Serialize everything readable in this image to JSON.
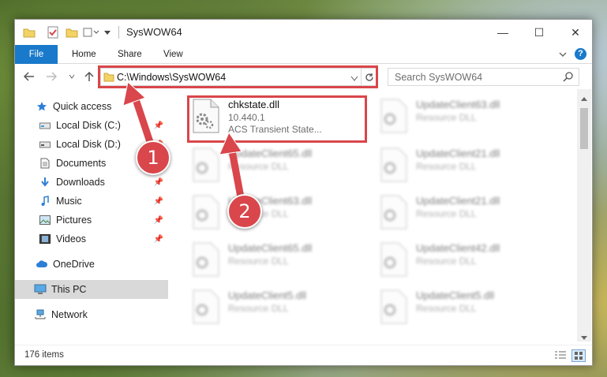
{
  "window": {
    "title": "SysWOW64",
    "controls": {
      "minimize": "—",
      "maximize": "☐",
      "close": "✕"
    }
  },
  "ribbon": {
    "tabs": [
      {
        "label": "File"
      },
      {
        "label": "Home"
      },
      {
        "label": "Share"
      },
      {
        "label": "View"
      }
    ],
    "collapse_icon": "chevron-down-icon",
    "help_label": "?"
  },
  "address_bar": {
    "path": "C:\\Windows\\SysWOW64",
    "search_placeholder": "Search SysWOW64"
  },
  "nav_pane": {
    "items": [
      {
        "label": "Quick access",
        "icon": "star-icon",
        "pinned": false
      },
      {
        "label": "Local Disk (C:)",
        "icon": "drive-icon",
        "pinned": true
      },
      {
        "label": "Local Disk (D:)",
        "icon": "drive-icon",
        "pinned": true
      },
      {
        "label": "Documents",
        "icon": "documents-icon",
        "pinned": true
      },
      {
        "label": "Downloads",
        "icon": "download-icon",
        "pinned": true
      },
      {
        "label": "Music",
        "icon": "music-icon",
        "pinned": true
      },
      {
        "label": "Pictures",
        "icon": "pictures-icon",
        "pinned": true
      },
      {
        "label": "Videos",
        "icon": "videos-icon",
        "pinned": true
      },
      {
        "label": "OneDrive",
        "icon": "cloud-icon",
        "pinned": false
      },
      {
        "label": "This PC",
        "icon": "computer-icon",
        "pinned": false,
        "selected": true
      },
      {
        "label": "Network",
        "icon": "network-icon",
        "pinned": false
      }
    ]
  },
  "files": {
    "highlighted": {
      "name": "chkstate.dll",
      "version": "10.440.1",
      "description": "ACS Transient State..."
    },
    "left_column": [
      {
        "name": "UpdateClient65.dll",
        "type": "Resource DLL"
      },
      {
        "name": "UpdateClient63.dll",
        "type": "Resource DLL"
      },
      {
        "name": "UpdateClient65.dll",
        "type": "Resource DLL"
      },
      {
        "name": "UpdateClient5.dll",
        "type": "Resource DLL"
      }
    ],
    "right_column": [
      {
        "name": "UpdateClient63.dll",
        "type": "Resource DLL"
      },
      {
        "name": "UpdateClient21.dll",
        "type": "Resource DLL"
      },
      {
        "name": "UpdateClient21.dll",
        "type": "Resource DLL"
      },
      {
        "name": "UpdateClient42.dll",
        "type": "Resource DLL"
      },
      {
        "name": "UpdateClient5.dll",
        "type": "Resource DLL"
      }
    ]
  },
  "status_bar": {
    "item_count": "176 items"
  },
  "callouts": [
    {
      "number": "1"
    },
    {
      "number": "2"
    }
  ],
  "colors": {
    "accent": "#1979ca",
    "callout": "#d9464b"
  }
}
